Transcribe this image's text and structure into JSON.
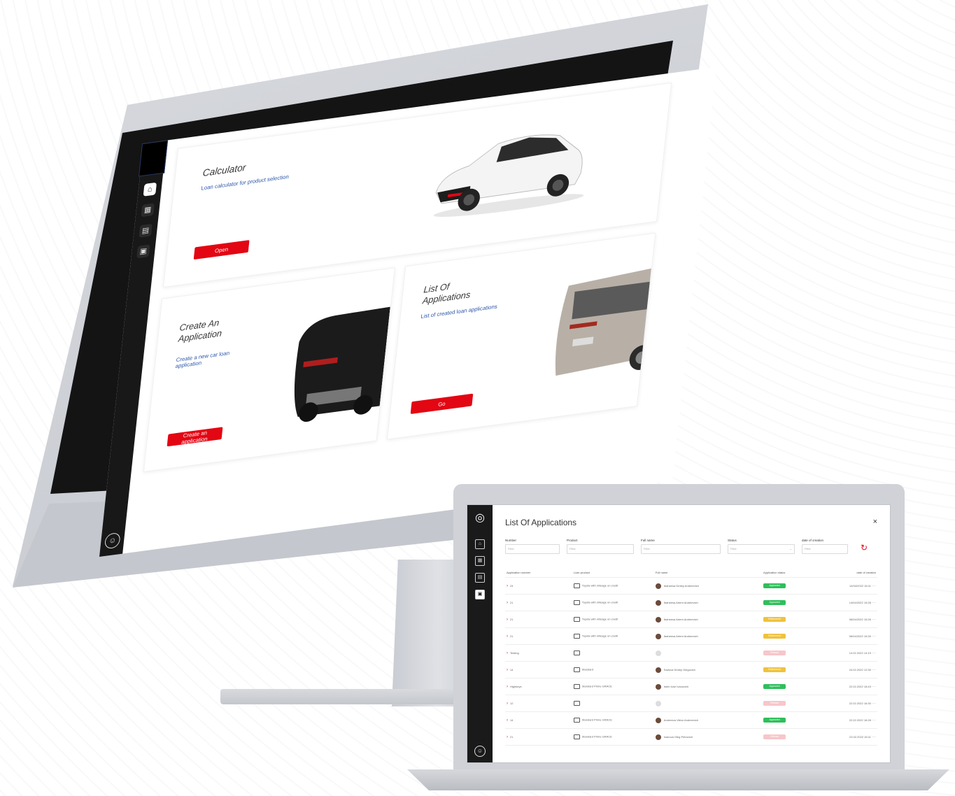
{
  "desktop": {
    "sidebar": {
      "icons": [
        "home-icon",
        "calculator-icon",
        "document-icon",
        "list-icon"
      ],
      "user_icon": "user-icon"
    },
    "calculator_card": {
      "title": "Calculator",
      "subtitle": "Loan calculator for product selection",
      "button": "Open"
    },
    "create_card": {
      "title": "Create An Application",
      "subtitle": "Create a new car loan application",
      "button": "Create an application"
    },
    "list_card": {
      "title": "List Of Applications",
      "subtitle": "List of created loan applications",
      "button": "Go"
    }
  },
  "laptop": {
    "title": "List Of Applications",
    "close": "×",
    "logo": "toyota-logo",
    "filters": [
      {
        "label": "Number",
        "placeholder": "Filter"
      },
      {
        "label": "Product",
        "placeholder": "Filter"
      },
      {
        "label": "Full name",
        "placeholder": "Filter"
      },
      {
        "label": "Status",
        "placeholder": "Filter"
      },
      {
        "label": "date of creation",
        "placeholder": "Filter"
      }
    ],
    "columns": [
      "Application number",
      "Loan product",
      "Full name",
      "Application status",
      "date of creation"
    ],
    "status_colors": {
      "approved": "#2fbf5b",
      "refinement": "#f0c23c",
      "refusal": "#f7c6ca"
    },
    "rows": [
      {
        "number": "24",
        "product": "Toyota with mileage on credit",
        "name": "Ibaheesa Dmitry Andreevich",
        "status": "Approved",
        "status_kind": "approved",
        "date": "14/04/2022 16:11"
      },
      {
        "number": "21",
        "product": "Toyota with mileage on credit",
        "name": "Ibaheesa Artem Andreevich",
        "status": "Approved",
        "status_kind": "approved",
        "date": "14/04/2022 15:28"
      },
      {
        "number": "21",
        "product": "Toyota with mileage on credit",
        "name": "Ibaheesa Artem Andreevich",
        "status": "Refinement",
        "status_kind": "refinement",
        "date": "06/04/2022 15:26"
      },
      {
        "number": "21",
        "product": "Toyota with mileage on credit",
        "name": "Ibaheesa Artem Andreevich",
        "status": "Refinement",
        "status_kind": "refinement",
        "date": "06/04/2022 15:26"
      },
      {
        "number": "Testing",
        "product": "",
        "name": "",
        "status": "Refusal",
        "status_kind": "refusal",
        "date": "14.02.2022 14:19"
      },
      {
        "number": "14",
        "product": "Standard",
        "name": "Sadova Dmitry Olegovich",
        "status": "Refinement",
        "status_kind": "refinement",
        "date": "24.02.2022 12:30"
      },
      {
        "number": "Highkeys",
        "product": "Standard Prime GRACE",
        "name": "Istrin Ivan Ivanovich",
        "status": "Approved",
        "status_kind": "approved",
        "date": "22.02.2022 16:43"
      },
      {
        "number": "12",
        "product": "",
        "name": "",
        "status": "Refusal",
        "status_kind": "refusal",
        "date": "22.02.2022 16:30"
      },
      {
        "number": "14",
        "product": "Standard Prime GRACE",
        "name": "Andreeva Viktor Andreevich",
        "status": "Approved",
        "status_kind": "approved",
        "date": "22.02.2022 16:28"
      },
      {
        "number": "21",
        "product": "Standard Prime GRACE",
        "name": "Ivanova Oleg Petrovich",
        "status": "Refusal",
        "status_kind": "refusal",
        "date": "23.02.2022 16:11"
      }
    ]
  }
}
